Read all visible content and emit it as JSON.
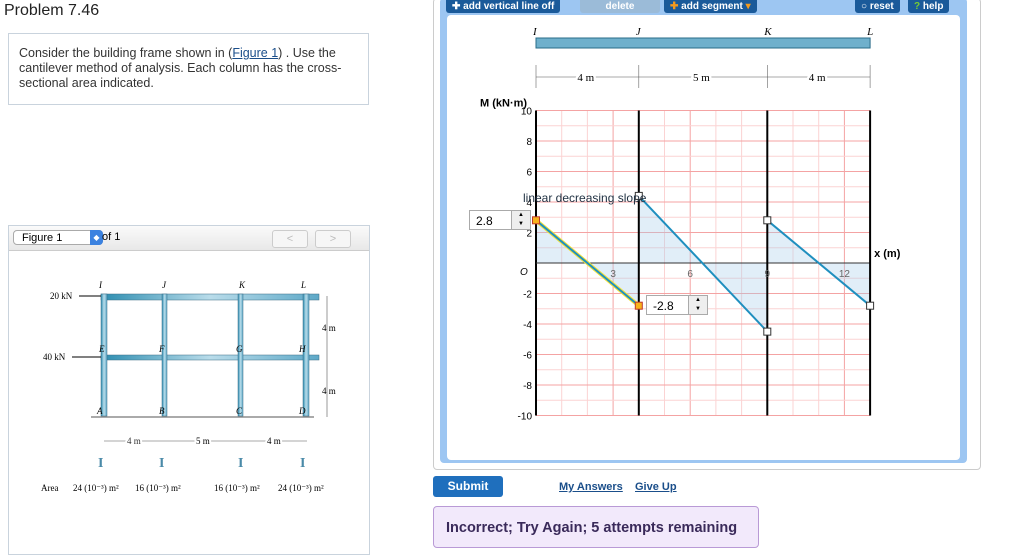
{
  "problem": {
    "title": "Problem 7.46",
    "text_pre": "Consider the building frame shown in (",
    "figure_link": "Figure 1",
    "text_post": ") . Use the cantilever method of analysis. Each column has the cross-sectional area indicated."
  },
  "figure_panel": {
    "selector": "Figure 1",
    "of": "of 1",
    "prev": "<",
    "next": ">",
    "loads": [
      "20 kN",
      "40 kN"
    ],
    "joints": [
      "I",
      "J",
      "K",
      "L",
      "E",
      "F",
      "G",
      "H",
      "A",
      "B",
      "C",
      "D"
    ],
    "heights": [
      "4 m",
      "4 m"
    ],
    "spans": [
      "4 m",
      "5 m",
      "4 m"
    ],
    "area_label": "Area",
    "areas": [
      "24 (10⁻³) m²",
      "16 (10⁻³) m²",
      "16 (10⁻³) m²",
      "24 (10⁻³) m²"
    ]
  },
  "toolbar": {
    "vline": "add vertical line off",
    "delete": "delete",
    "add_segment": "add segment",
    "reset": "reset",
    "help": "help"
  },
  "beam": {
    "joints": [
      "I",
      "J",
      "K",
      "L"
    ],
    "spans": [
      "4 m",
      "5 m",
      "4 m"
    ]
  },
  "chart_data": {
    "type": "line",
    "ylabel": "M (kN·m)",
    "xlabel": "x (m)",
    "origin_label": "O",
    "xlim": [
      0,
      13
    ],
    "ylim": [
      -10,
      10
    ],
    "xticks": [
      3,
      6,
      9,
      12
    ],
    "yticks": [
      10,
      8,
      6,
      4,
      2,
      -2,
      -4,
      -6,
      -8,
      -10
    ],
    "supports": [
      0,
      4,
      9,
      13
    ],
    "segments": [
      {
        "x": [
          0,
          4
        ],
        "y": [
          2.8,
          -2.8
        ],
        "selected": true
      },
      {
        "x": [
          4,
          9
        ],
        "y": [
          4.4,
          -4.5
        ]
      },
      {
        "x": [
          9,
          13
        ],
        "y": [
          2.8,
          -2.8
        ]
      }
    ],
    "annotation": "linear decreasing slope",
    "inputs": [
      "2.8",
      "-2.8"
    ]
  },
  "actions": {
    "submit": "Submit",
    "my_answers": "My Answers",
    "give_up": "Give Up"
  },
  "feedback": "Incorrect; Try Again; 5 attempts remaining"
}
